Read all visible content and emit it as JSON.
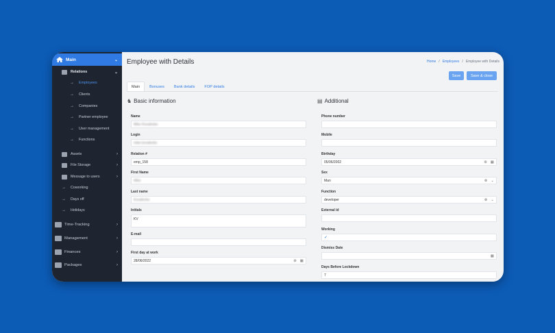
{
  "sidebar": {
    "main_label": "Main",
    "relations_label": "Relations",
    "relations_items": [
      "Employees",
      "Clients",
      "Companies",
      "Partner employee",
      "User management",
      "Functions"
    ],
    "main_items": [
      "Assets",
      "File Storage",
      "Message to users",
      "Coworking",
      "Days off",
      "Holidays"
    ],
    "top_items": [
      "Time-Tracking",
      "Management",
      "Finances",
      "Packages"
    ]
  },
  "header": {
    "title": "Employee with Details",
    "breadcrumb": [
      "Home",
      "Employees",
      "Employee with Details"
    ],
    "breadcrumb_sep": "/"
  },
  "actions": {
    "save_label": "Save",
    "save_close_label": "Save & close"
  },
  "tabs": [
    "Main",
    "Bonuses",
    "Bank details",
    "FOP details"
  ],
  "basic": {
    "title": "Basic information",
    "name_label": "Name",
    "name_value": "Mike Kovalenko",
    "login_label": "Login",
    "login_value": "mike.kovalenko",
    "relation_label": "Relation #",
    "relation_value": "emp_158",
    "first_name_label": "First Name",
    "first_name_value": "Mike",
    "last_name_label": "Last name",
    "last_name_value": "Kovalenko",
    "initials_label": "Initials",
    "initials_value": "KV",
    "email_label": "E-mail",
    "email_value": "",
    "first_day_label": "First day at work",
    "first_day_value": "28/06/2022"
  },
  "additional": {
    "title": "Additional",
    "phone_label": "Phone number",
    "phone_value": "",
    "mobile_label": "Mobile",
    "mobile_value": "",
    "birthday_label": "Birthday",
    "birthday_value": "05/06/2002",
    "sex_label": "Sex",
    "sex_value": "Man",
    "function_label": "Function",
    "function_value": "developer",
    "external_id_label": "External id",
    "external_id_value": "",
    "working_label": "Working",
    "working_value": "✓",
    "dismiss_label": "Dismiss Date",
    "dismiss_value": "",
    "days_lockdown_label": "Days Before Lockdown",
    "days_lockdown_value": "7"
  },
  "icons": {
    "clear": "⊗",
    "calendar": "▦",
    "chevron": "⌄",
    "arrow": "→",
    "chev_right": "›",
    "chev_down": "⌄"
  },
  "colors": {
    "accent": "#2f7be3",
    "sidebar_bg": "#1e2430",
    "button": "#6aa4f0",
    "page_bg": "#0c5bb5"
  }
}
